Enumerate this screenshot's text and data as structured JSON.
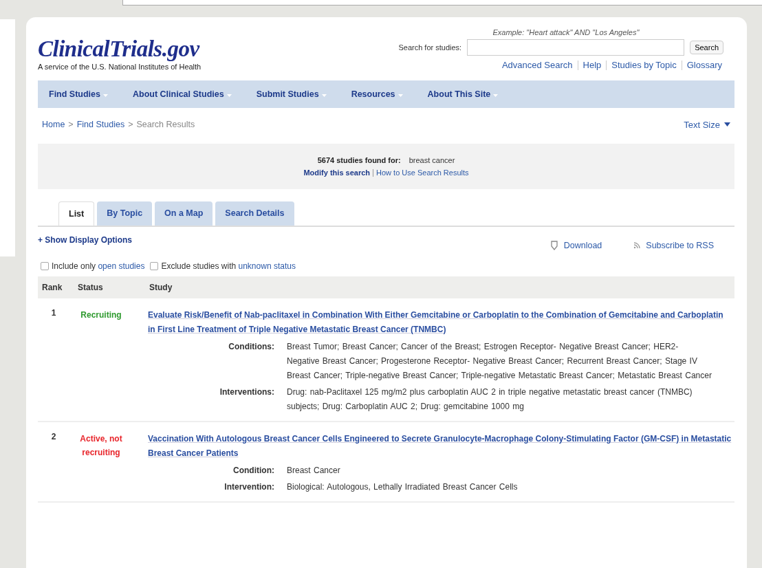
{
  "logo": {
    "title": "ClinicalTrials.gov",
    "tagline": "A service of the U.S. National Institutes of Health"
  },
  "search": {
    "example": "Example: \"Heart attack\" AND \"Los Angeles\"",
    "label": "Search for studies:",
    "button": "Search",
    "links": [
      "Advanced Search",
      "Help",
      "Studies by Topic",
      "Glossary"
    ]
  },
  "nav": [
    "Find Studies",
    "About Clinical Studies",
    "Submit Studies",
    "Resources",
    "About This Site"
  ],
  "breadcrumb": {
    "links": [
      "Home",
      "Find Studies"
    ],
    "separators": [
      ">",
      ">"
    ],
    "current": "Search Results"
  },
  "text_size": "Text Size",
  "results": {
    "count": "5674 studies found for:",
    "query": "breast cancer",
    "modify": "Modify this search",
    "howto": "How to Use Search Results"
  },
  "tabs": [
    {
      "label": "List",
      "selected": true
    },
    {
      "label": "By Topic",
      "selected": false
    },
    {
      "label": "On a Map",
      "selected": false
    },
    {
      "label": "Search Details",
      "selected": false
    }
  ],
  "display_options": "+ Show Display Options",
  "download": "Download",
  "rss": "Subscribe to RSS",
  "filters": [
    {
      "text": "Include only",
      "link": "open studies",
      "checked": false
    },
    {
      "text": "Exclude studies with",
      "link": "unknown status",
      "checked": false
    }
  ],
  "table": {
    "columns": [
      "Rank",
      "Status",
      "Study"
    ],
    "rows": [
      {
        "rank": "1",
        "status": "Recruiting",
        "color": "#2e9a2e",
        "title": "Evaluate Risk/Benefit of Nab-paclitaxel in Combination With Either Gemcitabine or Carboplatin to the Combination of Gemcitabine and Carboplatin in First Line Treatment of Triple Negative Metastatic Breast Cancer (TNMBC)",
        "details": [
          {
            "label": "Conditions:",
            "value": "Breast Tumor;   Breast Cancer;   Cancer of the Breast;   Estrogen Receptor- Negative Breast Cancer;   HER2- Negative Breast Cancer;   Progesterone Receptor- Negative Breast Cancer;   Recurrent Breast Cancer;   Stage IV Breast Cancer;   Triple-negative Breast Cancer;   Triple-negative Metastatic Breast Cancer;   Metastatic Breast Cancer"
          },
          {
            "label": "Interventions:",
            "value": "Drug: nab-Paclitaxel 125 mg/m2 plus carboplatin AUC 2 in triple negative metastatic breast cancer (TNMBC) subjects;   Drug: Carboplatin AUC 2;   Drug: gemcitabine 1000 mg"
          }
        ]
      },
      {
        "rank": "2",
        "status": "Active, not recruiting",
        "color": "#e8252b",
        "title": "Vaccination With Autologous Breast Cancer Cells Engineered to Secrete Granulocyte-Macrophage Colony-Stimulating Factor (GM-CSF) in Metastatic Breast Cancer Patients",
        "details": [
          {
            "label": "Condition:",
            "value": "Breast Cancer"
          },
          {
            "label": "Intervention:",
            "value": "Biological: Autologous, Lethally Irradiated Breast Cancer Cells"
          }
        ]
      }
    ]
  }
}
